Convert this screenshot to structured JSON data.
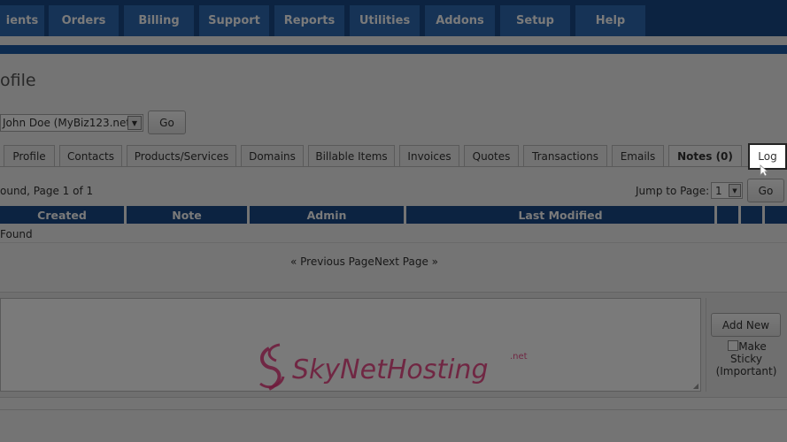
{
  "nav": {
    "items": [
      "ients",
      "Orders",
      "Billing",
      "Support",
      "Reports",
      "Utilities",
      "Addons",
      "Setup",
      "Help"
    ]
  },
  "page": {
    "title": "ofile"
  },
  "client": {
    "selected": "John Doe (MyBiz123.net)",
    "go_label": "Go"
  },
  "tabs": [
    "Profile",
    "Contacts",
    "Products/Services",
    "Domains",
    "Billable Items",
    "Invoices",
    "Quotes",
    "Transactions",
    "Emails",
    "Notes (0)",
    "Log"
  ],
  "records": {
    "summary": "ound, Page 1 of 1",
    "jump_label": "Jump to Page:",
    "page_value": "1",
    "go_label": "Go"
  },
  "table": {
    "headers": [
      "Created",
      "Note",
      "Admin",
      "Last Modified",
      "",
      "",
      ""
    ],
    "empty_text": "Found"
  },
  "pager": {
    "previous": "« Previous Page",
    "next": "Next Page »"
  },
  "add_note": {
    "button": "Add New",
    "sticky_label": "Make Sticky (Important)"
  },
  "watermark": {
    "text": "SkyNetHosting",
    "suffix": ".net"
  },
  "colors": {
    "nav_bg": "#1b4a88",
    "nav_button": "#2f6bb5",
    "header_bg": "#1b4a88",
    "watermark": "#e8357a"
  },
  "icons": {
    "select_arrow": "chevron-down-icon",
    "cursor": "mouse-pointer-icon",
    "resize": "resize-grip-icon"
  }
}
